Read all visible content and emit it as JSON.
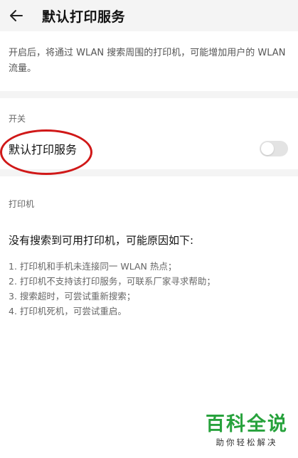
{
  "header": {
    "title": "默认打印服务",
    "back_icon": "arrow-left-icon"
  },
  "description": "开启后，将通过 WLAN 搜索周围的打印机，可能增加用户的 WLAN 流量。",
  "switch_section": {
    "label": "开关",
    "item_label": "默认打印服务",
    "enabled": false
  },
  "printer_section": {
    "label": "打印机",
    "empty_title": "没有搜索到可用打印机，可能原因如下:",
    "reasons": [
      "1. 打印机和手机未连接同一 WLAN 热点；",
      "2. 打印机不支持该打印服务，可联系厂家寻求帮助；",
      "3. 搜索超时，可尝试重新搜索；",
      "4. 打印机死机，可尝试重启。"
    ]
  },
  "watermark": {
    "title": "百科全说",
    "subtitle": "助你轻松解决"
  },
  "colors": {
    "highlight_circle": "#d01818",
    "watermark_green": "#27a23c"
  }
}
